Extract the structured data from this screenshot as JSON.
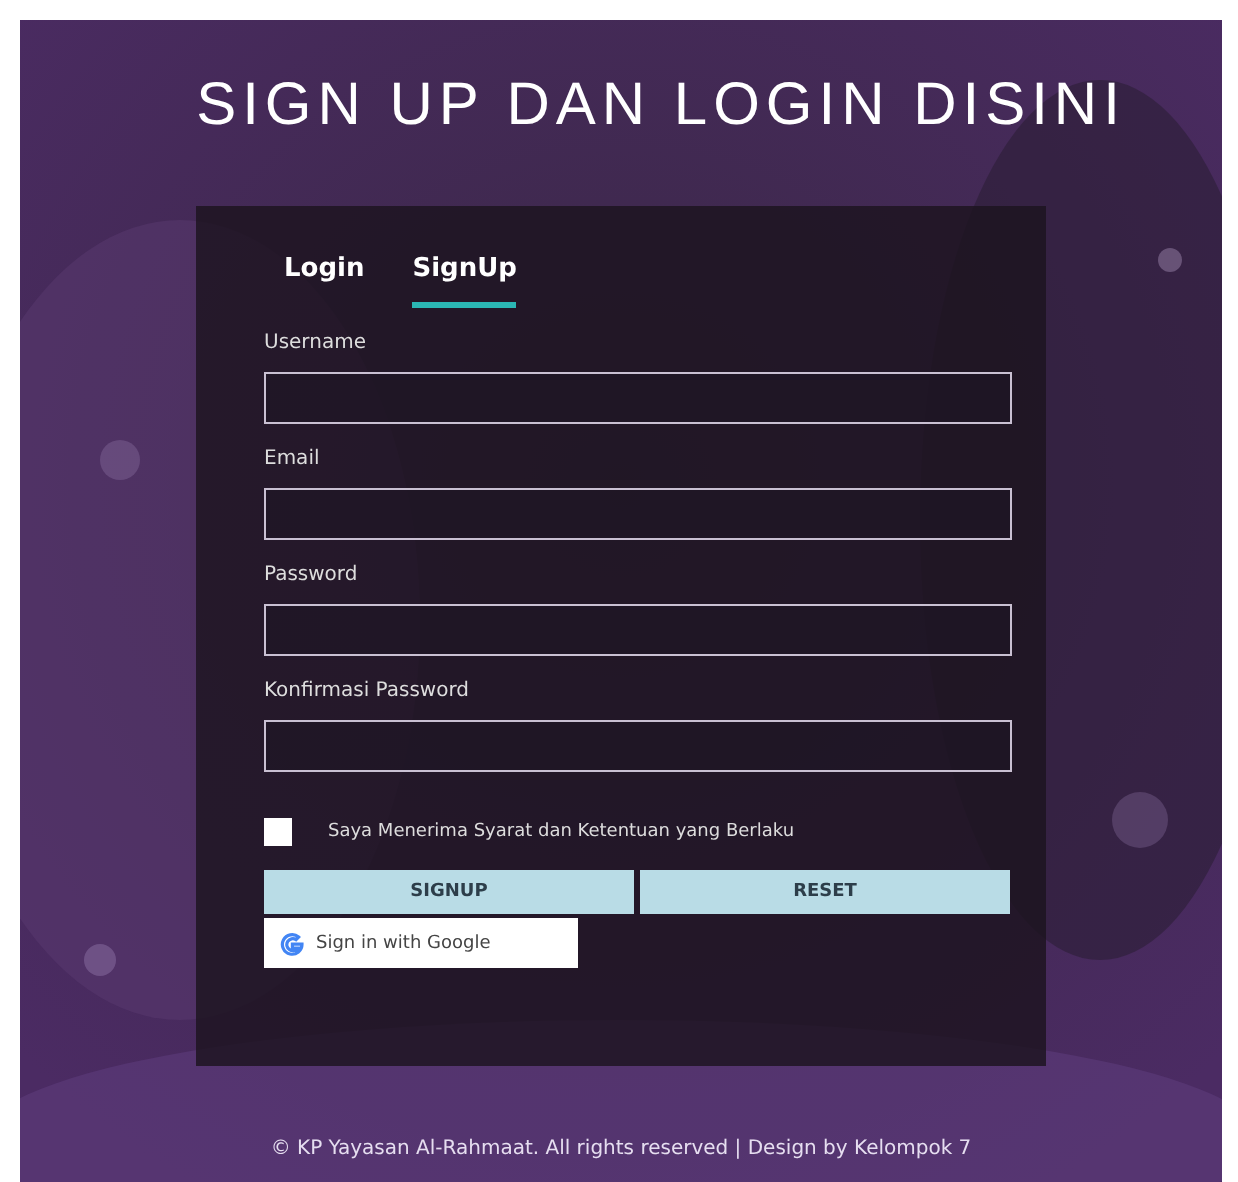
{
  "title": "SIGN UP DAN LOGIN DISINI",
  "tabs": [
    {
      "label": "Login",
      "selected": false
    },
    {
      "label": "SignUp",
      "selected": true
    }
  ],
  "fields": [
    {
      "label": "Username"
    },
    {
      "label": "Email"
    },
    {
      "label": "Password"
    },
    {
      "label": "Konfirmasi Password"
    }
  ],
  "terms": {
    "label": "Saya Menerima Syarat dan Ketentuan yang Berlaku",
    "checked": false
  },
  "buttons": [
    {
      "label": "SIGNUP"
    },
    {
      "label": "RESET"
    }
  ],
  "google_button": {
    "label": "Sign in with Google"
  },
  "footer": "© KP Yayasan Al-Rahmaat. All rights reserved | Design by Kelompok 7"
}
